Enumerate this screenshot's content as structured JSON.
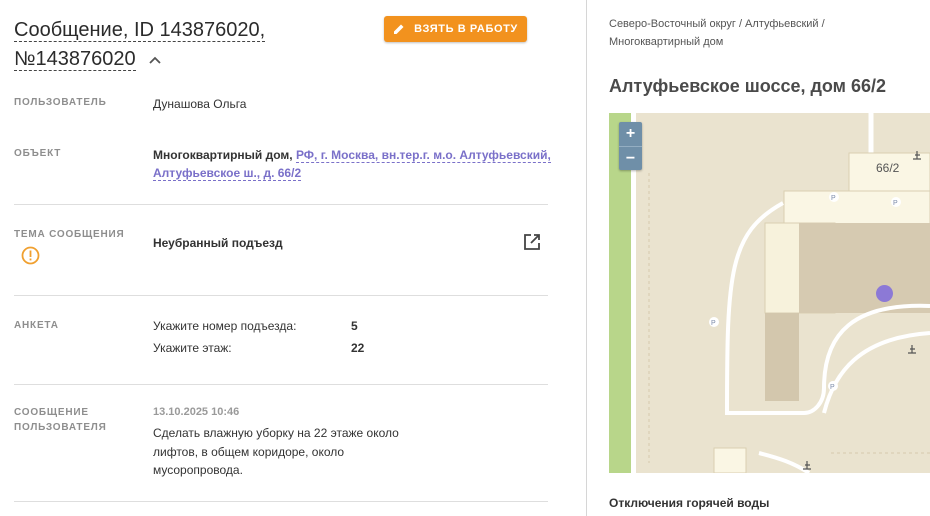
{
  "header": {
    "title": "Сообщение, ID 143876020, №143876020",
    "take_button_label": "ВЗЯТЬ В РАБОТУ"
  },
  "fields": {
    "user_label": "ПОЛЬЗОВАТЕЛЬ",
    "user_value": "Дунашова Ольга",
    "object_label": "ОБЪЕКТ",
    "object_type": "Многоквартирный дом,",
    "object_address": "РФ, г. Москва, вн.тер.г. м.о. Алтуфьевский, Алтуфьевское ш., д. 66/2",
    "topic_label": "ТЕМА СООБЩЕНИЯ",
    "topic_value": "Неубранный подъезд",
    "survey_label": "АНКЕТА",
    "survey": [
      {
        "question": "Укажите номер подъезда:",
        "answer": "5"
      },
      {
        "question": "Укажите этаж:",
        "answer": "22"
      }
    ],
    "message_label": "СООБЩЕНИЕ ПОЛЬЗОВАТЕЛЯ",
    "message_time": "13.10.2025 10:46",
    "message_text": "Сделать влажную уборку на 22 этаже около лифтов, в общем коридоре, около мусоропровода."
  },
  "right": {
    "breadcrumb": "Северо-Восточный округ / Алтуфьевский / Многоквартирный дом",
    "address": "Алтуфьевское шоссе, дом 66/2",
    "map": {
      "zoom_in": "+",
      "zoom_out": "−",
      "building_label": "66/2"
    },
    "section_title": "Отключения горячей воды"
  },
  "colors": {
    "accent_orange": "#f2921e",
    "link_purple": "#7a70c9",
    "marker_purple": "#8c79d6",
    "warning": "#f0a030"
  },
  "icons": [
    "pencil-icon",
    "chevron-up-icon",
    "warning-icon",
    "external-link-icon"
  ]
}
